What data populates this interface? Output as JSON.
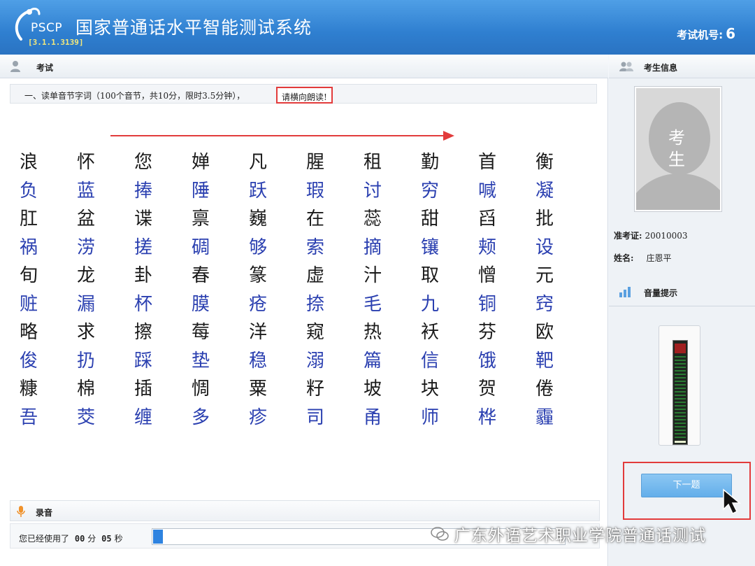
{
  "header": {
    "logo_text": "PSCP",
    "version": "[3.1.1.3139]",
    "title": "国家普通话水平智能测试系统",
    "machine_label": "考试机号:",
    "machine_number": "6"
  },
  "main": {
    "section_label": "考试",
    "instruction": "一、读单音节字词（100个音节，共10分，限时3.5分钟），",
    "instruction_hint": "请横向朗读!",
    "rows": [
      {
        "color": "black",
        "chars": [
          "浪",
          "怀",
          "您",
          "婵",
          "凡",
          "腥",
          "租",
          "勤",
          "首",
          "衡"
        ]
      },
      {
        "color": "blue",
        "chars": [
          "负",
          "蓝",
          "捧",
          "陲",
          "跃",
          "瑕",
          "讨",
          "穷",
          "喊",
          "凝"
        ]
      },
      {
        "color": "black",
        "chars": [
          "肛",
          "盆",
          "谍",
          "禀",
          "巍",
          "在",
          "蕊",
          "甜",
          "舀",
          "批"
        ]
      },
      {
        "color": "blue",
        "chars": [
          "祸",
          "涝",
          "搓",
          "碉",
          "够",
          "索",
          "摘",
          "镶",
          "颊",
          "设"
        ]
      },
      {
        "color": "black",
        "chars": [
          "旬",
          "龙",
          "卦",
          "春",
          "篆",
          "虚",
          "汁",
          "取",
          "憎",
          "元"
        ]
      },
      {
        "color": "blue",
        "chars": [
          "赃",
          "漏",
          "杯",
          "膜",
          "疮",
          "捺",
          "毛",
          "九",
          "铜",
          "窍"
        ]
      },
      {
        "color": "black",
        "chars": [
          "略",
          "求",
          "擦",
          "莓",
          "洋",
          "窥",
          "热",
          "袄",
          "芬",
          "欧"
        ]
      },
      {
        "color": "blue",
        "chars": [
          "俊",
          "扔",
          "踩",
          "垫",
          "稳",
          "溺",
          "篇",
          "信",
          "饿",
          "靶"
        ]
      },
      {
        "color": "black",
        "chars": [
          "糠",
          "棉",
          "插",
          "惆",
          "粟",
          "籽",
          "坡",
          "块",
          "贺",
          "倦"
        ]
      },
      {
        "color": "blue",
        "chars": [
          "吾",
          "茭",
          "缠",
          "多",
          "疹",
          "司",
          "甬",
          "师",
          "桦",
          "霾"
        ]
      }
    ],
    "record_label": "录音",
    "timer_prefix": "您已经使用了",
    "timer_minutes": "00",
    "timer_min_unit": "分",
    "timer_seconds": "05",
    "timer_sec_unit": "秒",
    "progress_fraction": 0.024
  },
  "side": {
    "candidate_header": "考生信息",
    "photo_label": "考生",
    "id_label": "准考证:",
    "id_value": "20010003",
    "name_label": "姓名:",
    "name_value": "庄恩平",
    "volume_header": "音量提示",
    "next_button": "下一题"
  },
  "watermark": "广东外语艺术职业学院普通话测试",
  "colors": {
    "header_blue": "#2f7fd0",
    "char_blue": "#2a3fb0",
    "highlight_red": "#e23b3b",
    "progress_blue": "#2e83e0"
  }
}
